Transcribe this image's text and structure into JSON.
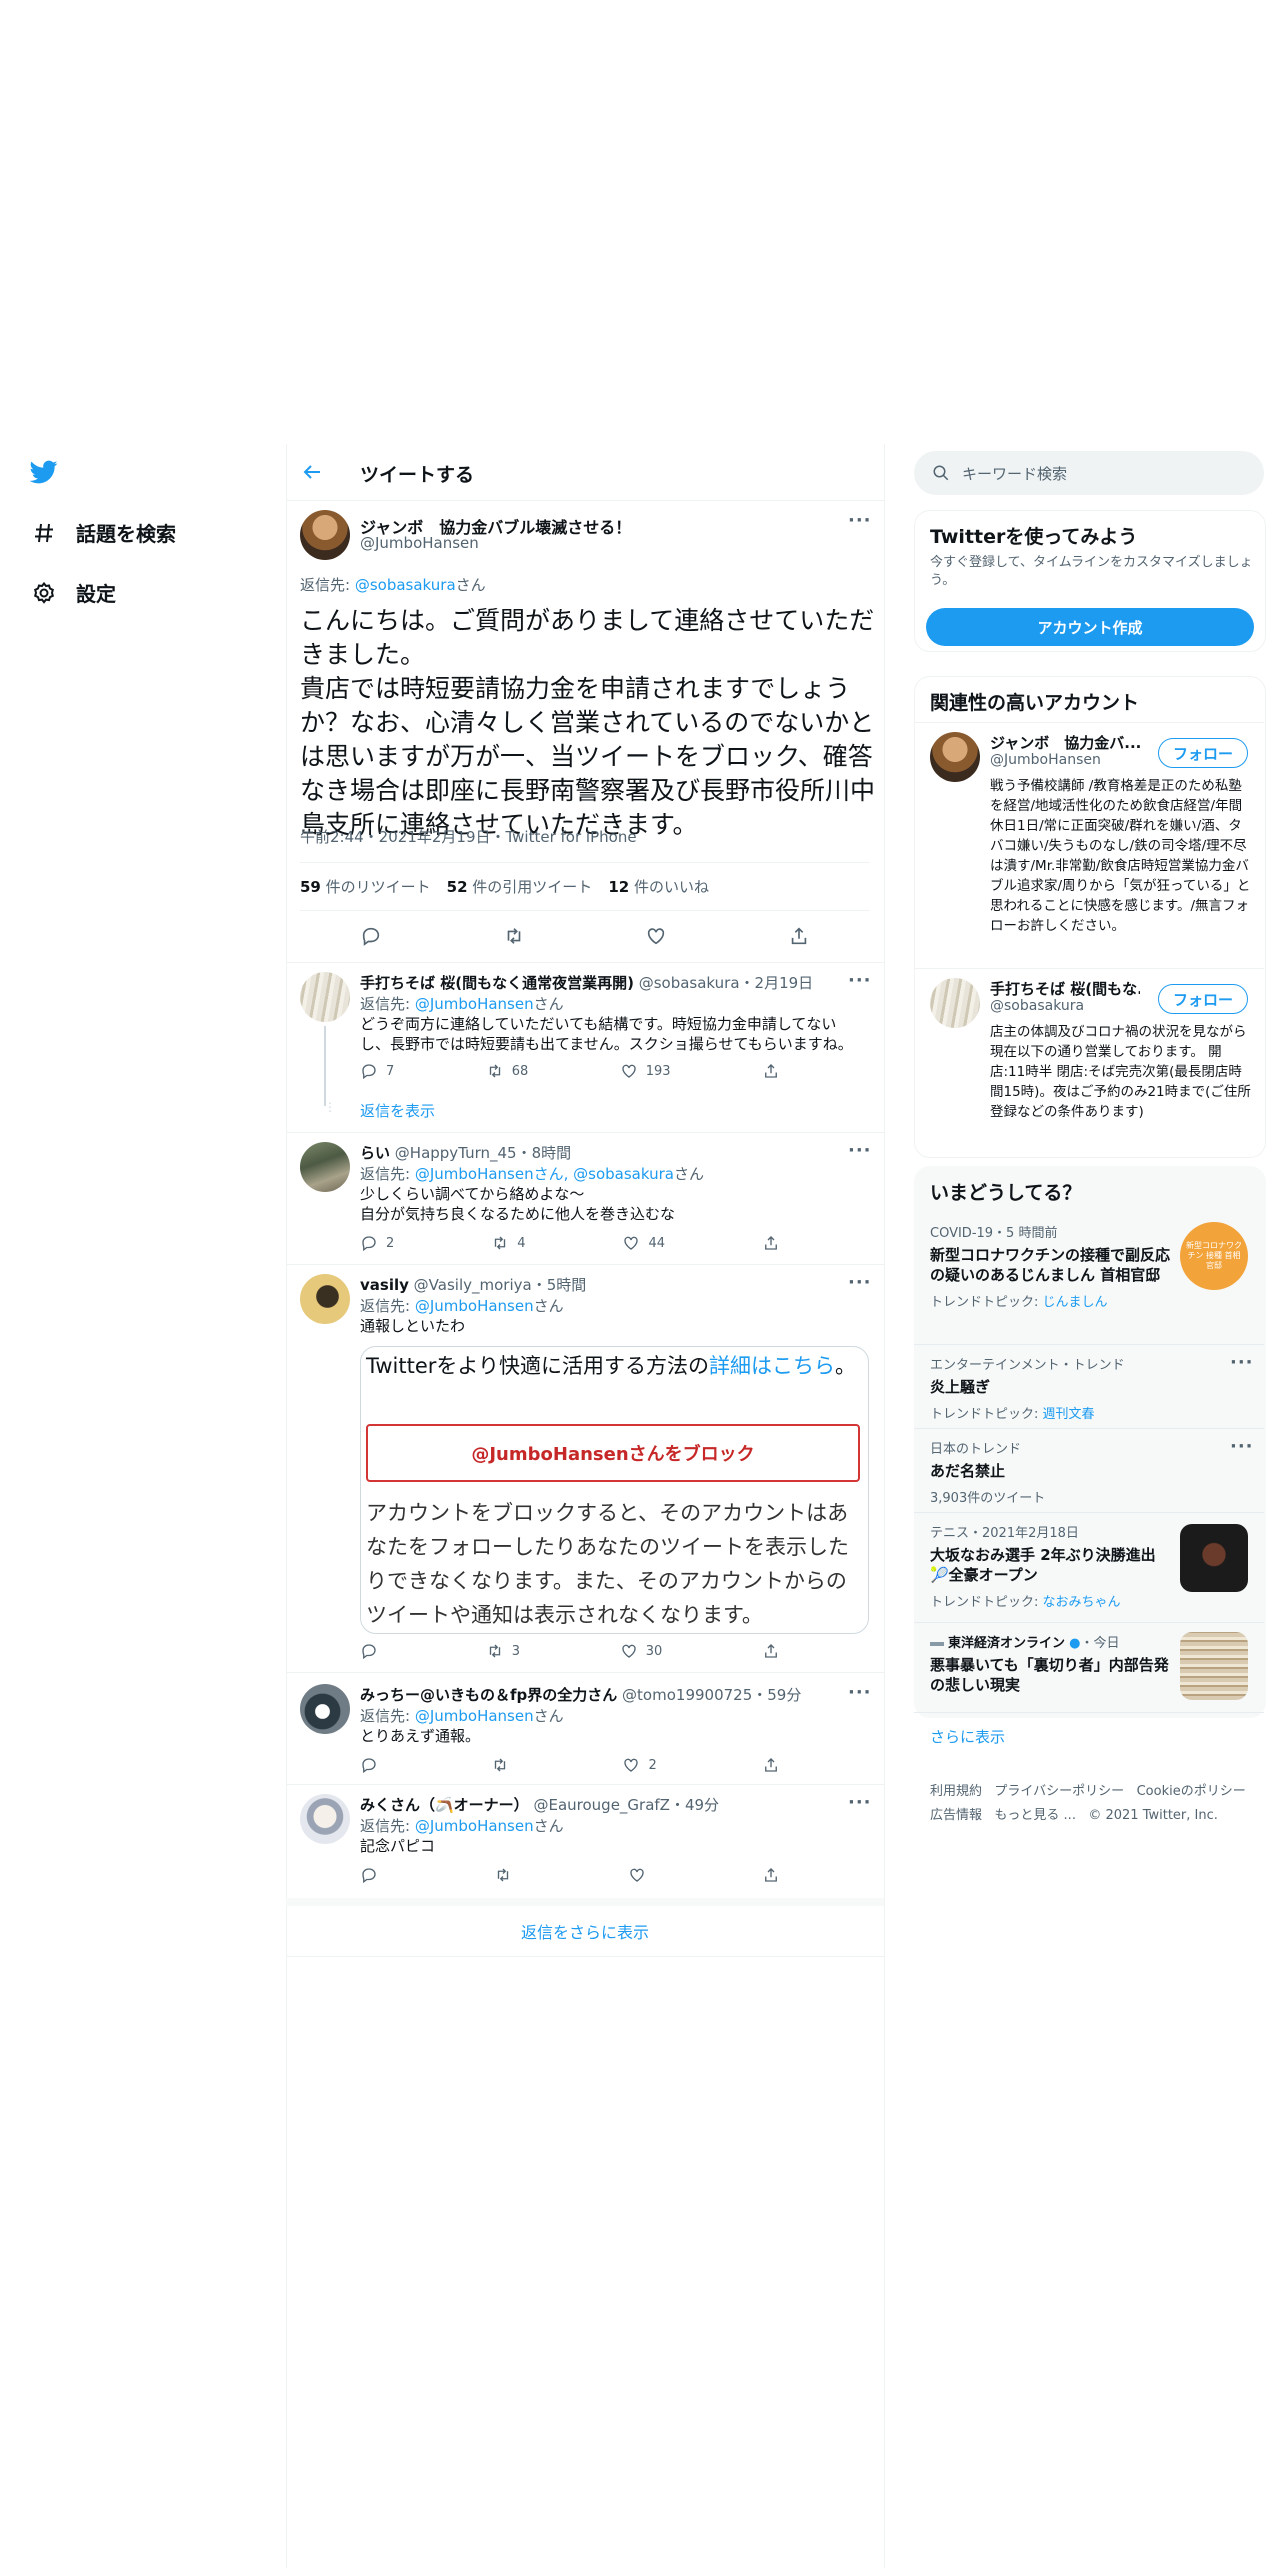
{
  "nav": {
    "explore_label": "話題を検索",
    "settings_label": "設定"
  },
  "header": {
    "title": "ツイートする"
  },
  "main_tweet": {
    "name": "ジャンボ　協力金バブル壊滅させる！",
    "handle": "@JumboHansen",
    "reply_prefix": "返信先: ",
    "reply_to": "@sobasakura",
    "reply_suffix": "さん",
    "text": "こんにちは。ご質問がありまして連絡させていただきました。\n貴店では時短要請協力金を申請されますでしょうか？なお、心清々しく営業されているのでないかとは思いますが万が一、当ツイートをブロック、確答なき場合は即座に長野南警察署及び長野市役所川中島支所に連絡させていただきます。",
    "meta": "午前2:44・2021年2月19日・Twitter for iPhone",
    "retweets_count": "59",
    "retweets_label": " 件のリツイート",
    "quotes_count": "52",
    "quotes_label": " 件の引用ツイート",
    "likes_count": "12",
    "likes_label": " 件のいいね"
  },
  "replies": [
    {
      "name": "手打ちそば 桜(間もなく通常夜営業再開)",
      "handle": "@sobasakura",
      "time": "・2月19日",
      "reply_prefix": "返信先: ",
      "reply_to": "@JumboHansen",
      "reply_suffix": "さん",
      "text": "どうぞ両方に連絡していただいても結構です。時短協力金申請してないし、長野市では時短要請も出てません。スクショ撮らせてもらいますね。",
      "replies": "7",
      "retweets": "68",
      "likes": "193",
      "show_replies": "返信を表示"
    },
    {
      "name": "らい",
      "handle": "@HappyTurn_45",
      "time": "・8時間",
      "reply_prefix": "返信先: ",
      "reply_to": "@JumboHansenさん, @sobasakura",
      "reply_suffix": "さん",
      "text": "少しくらい調べてから絡めよな〜\n自分が気持ち良くなるために他人を巻き込むな",
      "replies": "2",
      "retweets": "4",
      "likes": "44"
    },
    {
      "name": "vasily",
      "handle": "@Vasily_moriya",
      "time": "・5時間",
      "reply_prefix": "返信先: ",
      "reply_to": "@JumboHansen",
      "reply_suffix": "さん",
      "text": "通報しといたわ",
      "replies": "",
      "retweets": "3",
      "likes": "30"
    },
    {
      "name": "みっちー@いきもの＆fp界の全力さん",
      "handle": "@tomo19900725",
      "time": "・59分",
      "reply_prefix": "返信先: ",
      "reply_to": "@JumboHansen",
      "reply_suffix": "さん",
      "text": "とりあえず通報。",
      "replies": "",
      "retweets": "",
      "likes": "2"
    },
    {
      "name": "みくさん（🪃オーナー）",
      "handle": "@Eaurouge_GrafZ",
      "time": "・49分",
      "reply_prefix": "返信先: ",
      "reply_to": "@JumboHansen",
      "reply_suffix": "さん",
      "text": "記念パピコ",
      "replies": "",
      "retweets": "",
      "likes": ""
    }
  ],
  "block_card": {
    "tip_text": "Twitterをより快適に活用する方法の",
    "tip_link": "詳細はこちら",
    "tip_end": "。",
    "button_label": "@JumboHansenさんをブロック",
    "description": "アカウントをブロックすると、そのアカウントはあなたをフォローしたりあなたのツイートを表示したりできなくなります。また、そのアカウントからのツイートや通知は表示されなくなります。"
  },
  "show_more_replies": "返信をさらに表示",
  "search": {
    "placeholder": "キーワード検索"
  },
  "signup": {
    "title": "Twitterを使ってみよう",
    "text": "今すぐ登録して、タイムラインをカスタマイズしましょう。",
    "button": "アカウント作成"
  },
  "related": {
    "title": "関連性の高いアカウント",
    "accounts": [
      {
        "name": "ジャンボ　協力金バ...",
        "handle": "@JumboHansen",
        "follow": "フォロー",
        "bio": "戦う予備校講師 /教育格差是正のため私塾を経営/地域活性化のため飲食店経営/年間休日1日/常に正面突破/群れを嫌い/酒、タバコ嫌い/失うものなし/鉄の司令塔/理不尽は潰す/Mr.非常勤/飲食店時短営業協力金バブル追求家/周りから「気が狂っている」と思われることに快感を感じます。/無言フォローお許しください。"
      },
      {
        "name": "手打ちそば 桜(間もな...",
        "handle": "@sobasakura",
        "follow": "フォロー",
        "bio": "店主の体調及びコロナ禍の状況を見ながら現在以下の通り営業しております。 開店:11時半 閉店:そば完売次第(最長閉店時間15時)。夜はご予約のみ21時まで(ご住所登録などの条件あります)"
      }
    ]
  },
  "trends": {
    "title": "いまどうしてる？",
    "items": [
      {
        "category": "COVID-19・5 時間前",
        "title": "新型コロナワクチンの接種で副反応の疑いのあるじんましん 首相官邸",
        "sub_prefix": "トレンドトピック: ",
        "sub_link": "じんましん",
        "thumb_caption": "新型コロナワクチン 接種 首相官邸"
      },
      {
        "category": "エンターテインメント・トレンド",
        "title": "炎上騒ぎ",
        "sub_prefix": "トレンドトピック: ",
        "sub_link": "週刊文春"
      },
      {
        "category": "日本のトレンド",
        "title": "あだ名禁止",
        "sub_prefix": "3,903件のツイート",
        "sub_link": ""
      },
      {
        "category": "テニス・2021年2月18日",
        "title": "大坂なおみ選手 2年ぶり決勝進出 🎾全豪オープン",
        "sub_prefix": "トレンドトピック: ",
        "sub_link": "なおみちゃん"
      },
      {
        "category": "東洋経済オンライン",
        "category_time": "・今日",
        "title": "悪事暴いても「裏切り者」内部告発の悲しい現実",
        "sub_prefix": "",
        "sub_link": ""
      }
    ],
    "show_more": "さらに表示"
  },
  "footer": {
    "links": [
      "利用規約",
      "プライバシーポリシー",
      "Cookieのポリシー",
      "広告情報",
      "もっと見る ..."
    ],
    "copyright": "© 2021 Twitter, Inc."
  },
  "colors": {
    "accent": "#1d9bf0",
    "block_red": "#d33535"
  }
}
